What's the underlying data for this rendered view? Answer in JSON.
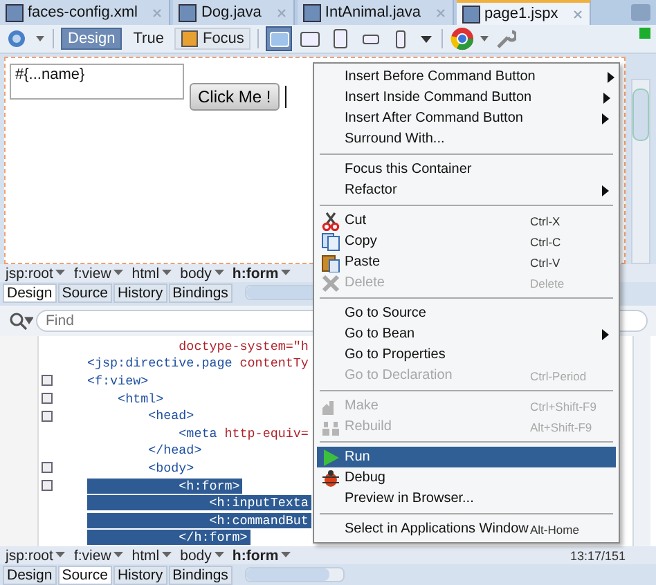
{
  "tabs": [
    {
      "label": "faces-config.xml",
      "selected": false
    },
    {
      "label": "Dog.java",
      "selected": false
    },
    {
      "label": "IntAnimal.java",
      "selected": false
    },
    {
      "label": "page1.jspx",
      "selected": true
    }
  ],
  "toolbar": {
    "modes": [
      {
        "label": "Design",
        "selected": true
      },
      {
        "label": "True",
        "selected": false
      }
    ],
    "focus": "Focus",
    "devices": [
      {
        "selected": true
      },
      {
        "selected": false
      },
      {
        "selected": false
      },
      {
        "selected": false
      },
      {
        "selected": false
      }
    ]
  },
  "design": {
    "text_area": "#{...name}",
    "button": "Click Me !"
  },
  "design_breadcrumb": [
    {
      "label": "jsp:root",
      "selected": false
    },
    {
      "label": "f:view",
      "selected": false
    },
    {
      "label": "html",
      "selected": false
    },
    {
      "label": "body",
      "selected": false
    },
    {
      "label": "h:form",
      "selected": true
    }
  ],
  "design_view_tabs": [
    {
      "label": "Design",
      "selected": true
    },
    {
      "label": "Source",
      "selected": false
    },
    {
      "label": "History",
      "selected": false
    },
    {
      "label": "Bindings",
      "selected": false
    }
  ],
  "find": {
    "placeholder": "Find"
  },
  "code_lines": [
    {
      "attr": "            doctype-system=\"h",
      "fold": false,
      "selected": false
    },
    {
      "tag": "<jsp:directive.page ",
      "attr": "contentTy",
      "fold": false,
      "selected": false
    },
    {
      "tag": "<f:view>",
      "fold": true,
      "selected": false
    },
    {
      "tag": "    <html>",
      "fold": true,
      "selected": false
    },
    {
      "tag": "        <head>",
      "fold": true,
      "selected": false
    },
    {
      "tag": "            <meta ",
      "attr": "http-equiv=",
      "fold": false,
      "selected": false
    },
    {
      "tag": "        </head>",
      "fold": false,
      "selected": false
    },
    {
      "tag": "        <body>",
      "fold": true,
      "selected": false
    },
    {
      "tag": "            <h:form>",
      "fold": true,
      "selected": true
    },
    {
      "tag": "                <h:inputTexta",
      "fold": false,
      "selected": true
    },
    {
      "tag": "                <h:commandBut",
      "fold": false,
      "selected": true
    },
    {
      "tag": "            </h:form>",
      "fold": false,
      "selected": true
    }
  ],
  "position": "13:17/151",
  "source_breadcrumb": [
    {
      "label": "jsp:root",
      "selected": false
    },
    {
      "label": "f:view",
      "selected": false
    },
    {
      "label": "html",
      "selected": false
    },
    {
      "label": "body",
      "selected": false
    },
    {
      "label": "h:form",
      "selected": true
    }
  ],
  "source_view_tabs": [
    {
      "label": "Design",
      "selected": false
    },
    {
      "label": "Source",
      "selected": true
    },
    {
      "label": "History",
      "selected": false
    },
    {
      "label": "Bindings",
      "selected": false
    }
  ],
  "context_menu": [
    {
      "kind": "item",
      "label": "Insert Before Command Button",
      "submenu": true,
      "disabled": false,
      "selected": false
    },
    {
      "kind": "item",
      "label": "Insert Inside Command Button",
      "submenu": true,
      "disabled": false,
      "selected": false
    },
    {
      "kind": "item",
      "label": "Insert After Command Button",
      "submenu": true,
      "disabled": false,
      "selected": false
    },
    {
      "kind": "item",
      "label": "Surround With...",
      "submenu": false,
      "disabled": false,
      "selected": false
    },
    {
      "kind": "separator"
    },
    {
      "kind": "item",
      "label": "Focus this Container",
      "submenu": false,
      "disabled": false,
      "selected": false
    },
    {
      "kind": "item",
      "label": "Refactor",
      "submenu": true,
      "disabled": false,
      "selected": false
    },
    {
      "kind": "separator"
    },
    {
      "kind": "item",
      "label": "Cut",
      "shortcut": "Ctrl-X",
      "submenu": false,
      "disabled": false,
      "selected": false
    },
    {
      "kind": "item",
      "label": "Copy",
      "shortcut": "Ctrl-C",
      "submenu": false,
      "disabled": false,
      "selected": false
    },
    {
      "kind": "item",
      "label": "Paste",
      "shortcut": "Ctrl-V",
      "submenu": false,
      "disabled": false,
      "selected": false
    },
    {
      "kind": "item",
      "label": "Delete",
      "shortcut": "Delete",
      "submenu": false,
      "disabled": true,
      "selected": false
    },
    {
      "kind": "separator"
    },
    {
      "kind": "item",
      "label": "Go to Source",
      "submenu": false,
      "disabled": false,
      "selected": false
    },
    {
      "kind": "item",
      "label": "Go to Bean",
      "submenu": true,
      "disabled": false,
      "selected": false
    },
    {
      "kind": "item",
      "label": "Go to Properties",
      "submenu": false,
      "disabled": false,
      "selected": false
    },
    {
      "kind": "item",
      "label": "Go to Declaration",
      "shortcut": "Ctrl-Period",
      "submenu": false,
      "disabled": true,
      "selected": false
    },
    {
      "kind": "separator"
    },
    {
      "kind": "item",
      "label": "Make",
      "shortcut": "Ctrl+Shift-F9",
      "submenu": false,
      "disabled": true,
      "selected": false
    },
    {
      "kind": "item",
      "label": "Rebuild",
      "shortcut": "Alt+Shift-F9",
      "submenu": false,
      "disabled": true,
      "selected": false
    },
    {
      "kind": "separator"
    },
    {
      "kind": "item",
      "label": "Run",
      "submenu": false,
      "disabled": false,
      "selected": true
    },
    {
      "kind": "item",
      "label": "Debug",
      "submenu": false,
      "disabled": false,
      "selected": false
    },
    {
      "kind": "item",
      "label": "Preview in Browser...",
      "submenu": false,
      "disabled": false,
      "selected": false
    },
    {
      "kind": "separator"
    },
    {
      "kind": "item",
      "label": "Select in Applications Window",
      "shortcut": "Alt-Home",
      "submenu": false,
      "disabled": false,
      "selected": false
    }
  ]
}
